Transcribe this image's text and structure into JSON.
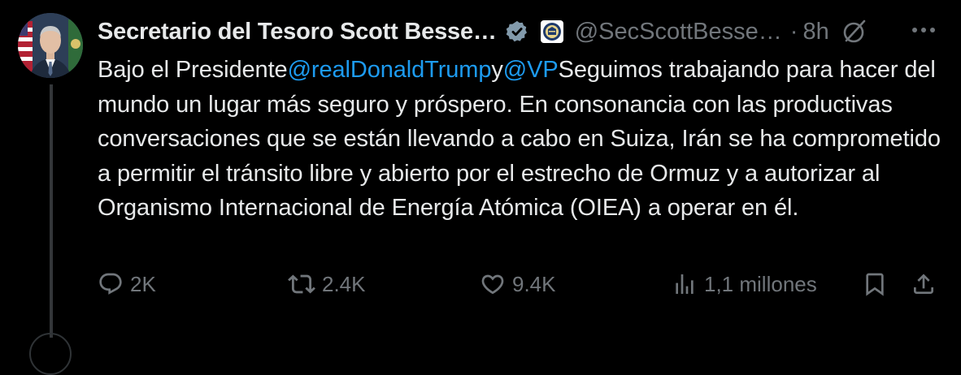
{
  "post": {
    "display_name": "Secretario del Tesoro Scott Besse…",
    "handle": "@SecScottBesse…",
    "separator": "·",
    "time": "8h",
    "body": {
      "segment_1": "Bajo el Presidente",
      "mention_1": "@realDonaldTrump",
      "segment_2": "y",
      "mention_2": "@VP",
      "segment_3": "Seguimos trabajando para hacer del mundo un lugar más seguro y próspero. En consonancia con las productivas conversaciones que se están llevando a cabo en Suiza, Irán se ha comprometido a permitir el tránsito libre y abierto por el estrecho de Ormuz y a autorizar al Organismo Internacional de Energía Atómica (OIEA) a operar en él."
    },
    "actions": {
      "replies": "2K",
      "reposts": "2.4K",
      "likes": "9.4K",
      "views": "1,1 millones"
    }
  },
  "icons": {
    "verified": "verified-badge-icon",
    "affiliate": "treasury-seal-icon",
    "grok": "grok-icon",
    "more": "more-options-icon",
    "reply": "reply-icon",
    "repost": "repost-icon",
    "like": "heart-icon",
    "views": "views-chart-icon",
    "bookmark": "bookmark-icon",
    "share": "share-icon"
  },
  "colors": {
    "background": "#000000",
    "text": "#e7e9ea",
    "muted": "#71767b",
    "link": "#1d9bf0",
    "thread_line": "#333639"
  }
}
